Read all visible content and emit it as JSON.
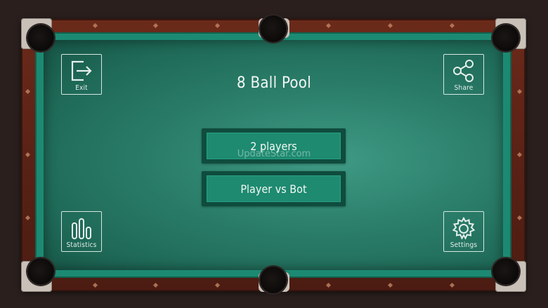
{
  "game": {
    "title": "8 Ball Pool"
  },
  "menu": {
    "buttons": [
      {
        "label": "2 players"
      },
      {
        "label": "Player vs Bot"
      }
    ]
  },
  "corners": {
    "exit": {
      "label": "Exit",
      "icon": "exit-icon"
    },
    "share": {
      "label": "Share",
      "icon": "share-icon"
    },
    "statistics": {
      "label": "Statistics",
      "icon": "statistics-icon"
    },
    "settings": {
      "label": "Settings",
      "icon": "gear-icon"
    }
  },
  "watermark": "UpdateStar.com",
  "colors": {
    "cloth": "#2b7f6b",
    "cushion": "#1c8a72",
    "rail": "#5a2216",
    "button": "#1e8a70"
  }
}
